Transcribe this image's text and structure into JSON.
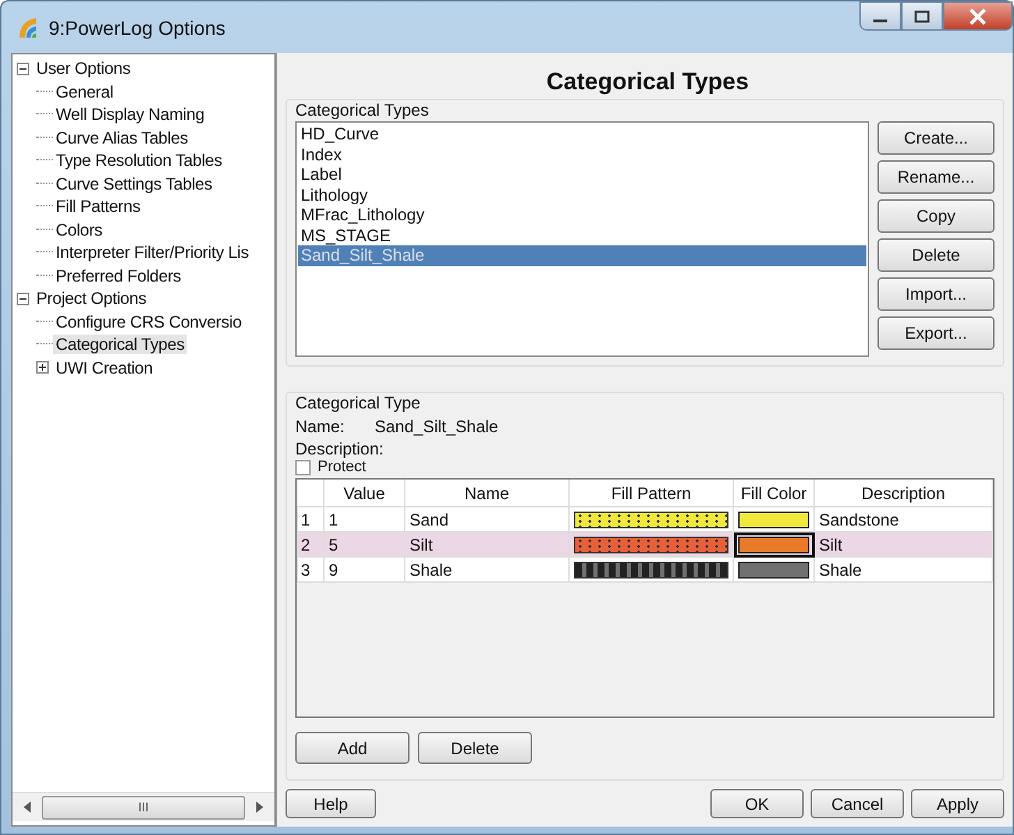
{
  "window": {
    "title": "9:PowerLog Options"
  },
  "tree": [
    {
      "label": "User Options",
      "expanded": true,
      "selected": false,
      "children": [
        {
          "label": "General",
          "selected": false
        },
        {
          "label": "Well Display Naming",
          "selected": false
        },
        {
          "label": "Curve Alias Tables",
          "selected": false
        },
        {
          "label": "Type Resolution Tables",
          "selected": false
        },
        {
          "label": "Curve Settings Tables",
          "selected": false
        },
        {
          "label": "Fill Patterns",
          "selected": false
        },
        {
          "label": "Colors",
          "selected": false
        },
        {
          "label": "Interpreter Filter/Priority Lis",
          "selected": false
        },
        {
          "label": "Preferred Folders",
          "selected": false
        }
      ]
    },
    {
      "label": "Project Options",
      "expanded": true,
      "selected": false,
      "children": [
        {
          "label": "Configure CRS Conversio",
          "selected": false
        },
        {
          "label": "Categorical Types",
          "selected": true
        },
        {
          "label": "UWI Creation",
          "expanded": false,
          "selected": false
        }
      ]
    }
  ],
  "heading": "Categorical Types",
  "types_group": {
    "legend": "Categorical Types",
    "items": [
      {
        "label": "HD_Curve",
        "selected": false
      },
      {
        "label": "Index",
        "selected": false
      },
      {
        "label": "Label",
        "selected": false
      },
      {
        "label": "Lithology",
        "selected": false
      },
      {
        "label": "MFrac_Lithology",
        "selected": false
      },
      {
        "label": "MS_STAGE",
        "selected": false
      },
      {
        "label": "Sand_Silt_Shale",
        "selected": true
      }
    ],
    "buttons": [
      "Create...",
      "Rename...",
      "Copy",
      "Delete",
      "Import...",
      "Export..."
    ]
  },
  "type_group": {
    "legend": "Categorical Type",
    "name_label": "Name:",
    "name_value": "Sand_Silt_Shale",
    "description_label": "Description:",
    "protect": {
      "label": "Protect",
      "checked": false
    },
    "columns": [
      "Value",
      "Name",
      "Fill Pattern",
      "Fill Color",
      "Description"
    ],
    "rows": [
      {
        "index": "1",
        "value": "1",
        "name": "Sand",
        "fill_pattern": {
          "kind": "dots",
          "color": "#f0e83a"
        },
        "color": "#f0e83a",
        "description": "Sandstone",
        "selected": false
      },
      {
        "index": "2",
        "value": "5",
        "name": "Silt",
        "fill_pattern": {
          "kind": "dots",
          "color": "#e8603a"
        },
        "color": "#e87a2a",
        "description": "Silt",
        "selected": true
      },
      {
        "index": "3",
        "value": "9",
        "name": "Shale",
        "fill_pattern": {
          "kind": "dashes",
          "color": "#707070"
        },
        "color": "#707070",
        "description": "Shale",
        "selected": false
      }
    ],
    "buttons": [
      "Add",
      "Delete"
    ]
  },
  "footer": {
    "help": "Help",
    "buttons": [
      "OK",
      "Cancel",
      "Apply"
    ]
  },
  "scrollbar": {
    "grip": "III"
  }
}
